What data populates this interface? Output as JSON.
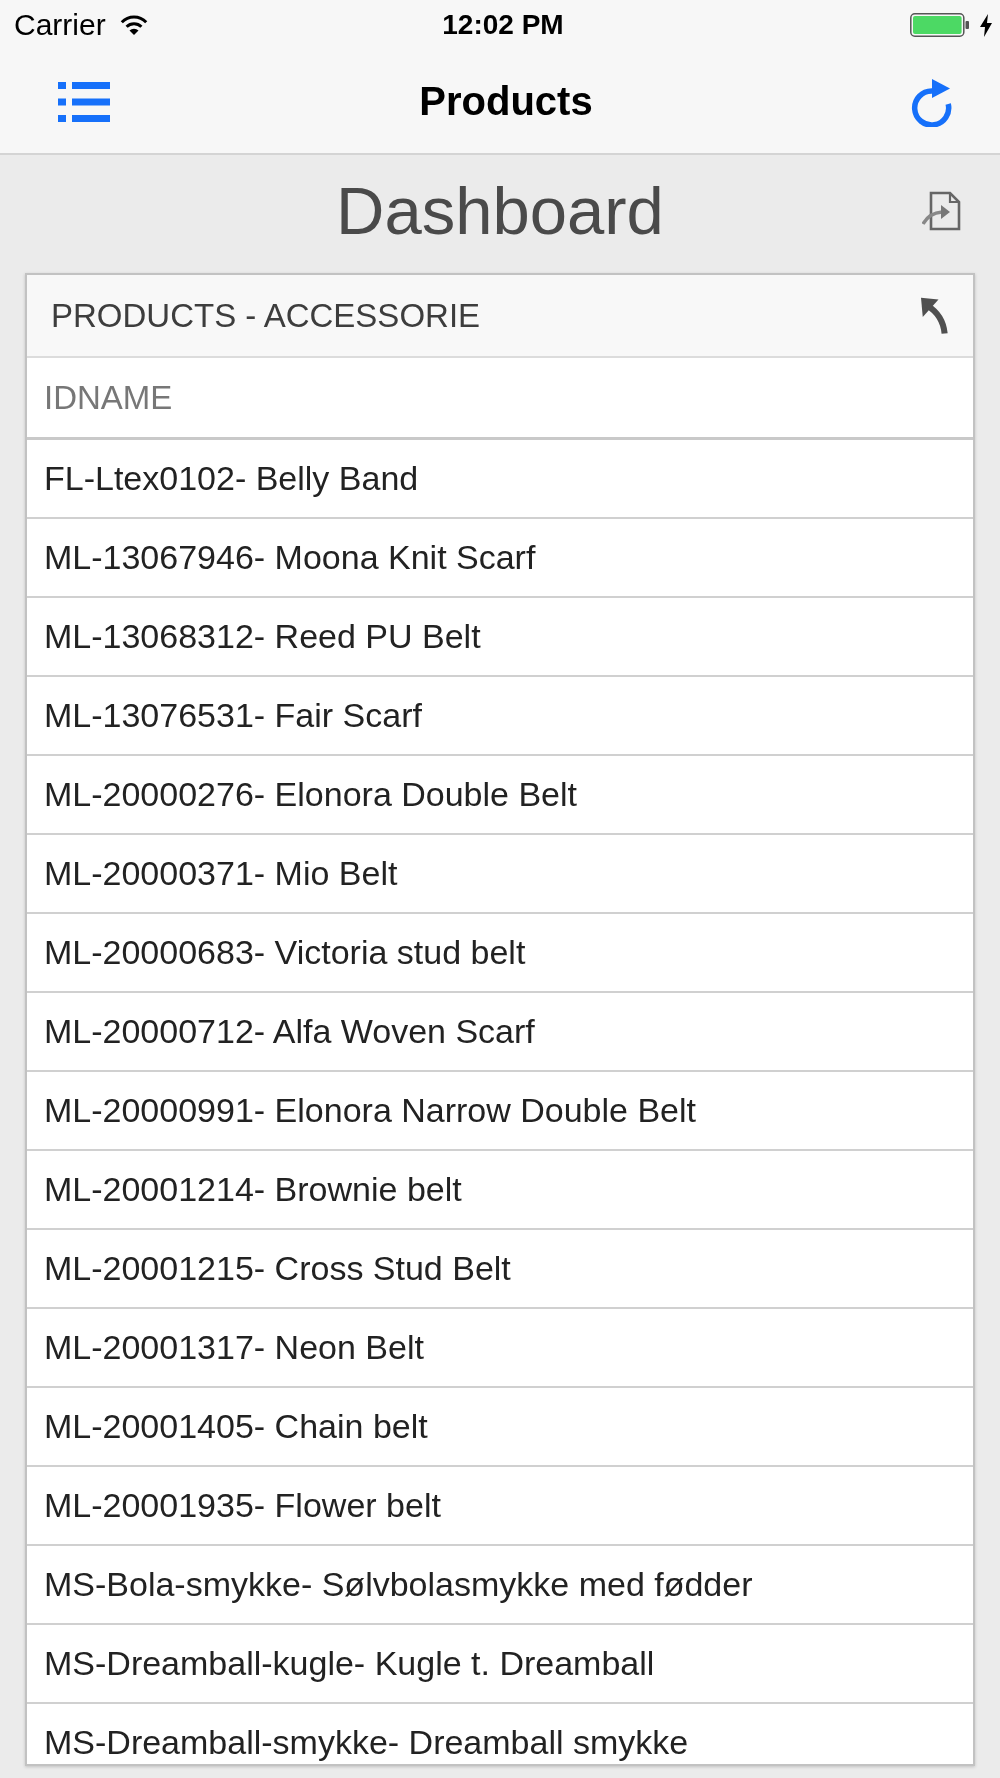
{
  "status_bar": {
    "carrier": "Carrier",
    "time": "12:02 PM",
    "charging": true
  },
  "nav_bar": {
    "title": "Products"
  },
  "dashboard": {
    "title": "Dashboard"
  },
  "card": {
    "title": "PRODUCTS - ACCESSORIE",
    "columns": [
      "IDNAME"
    ],
    "rows": [
      "FL-Ltex0102- Belly Band",
      "ML-13067946- Moona Knit Scarf",
      "ML-13068312- Reed PU Belt",
      "ML-13076531- Fair Scarf",
      "ML-20000276- Elonora Double Belt",
      "ML-20000371- Mio Belt",
      "ML-20000683- Victoria stud belt",
      "ML-20000712- Alfa Woven Scarf",
      "ML-20000991- Elonora Narrow Double Belt",
      "ML-20001214- Brownie belt",
      "ML-20001215- Cross Stud Belt",
      "ML-20001317- Neon Belt",
      "ML-20001405- Chain belt",
      "ML-20001935- Flower belt",
      "MS-Bola-smykke- Sølvbolasmykke med fødder",
      "MS-Dreamball-kugle- Kugle t. Dreamball",
      "MS-Dreamball-smykke- Dreamball smykke"
    ]
  }
}
